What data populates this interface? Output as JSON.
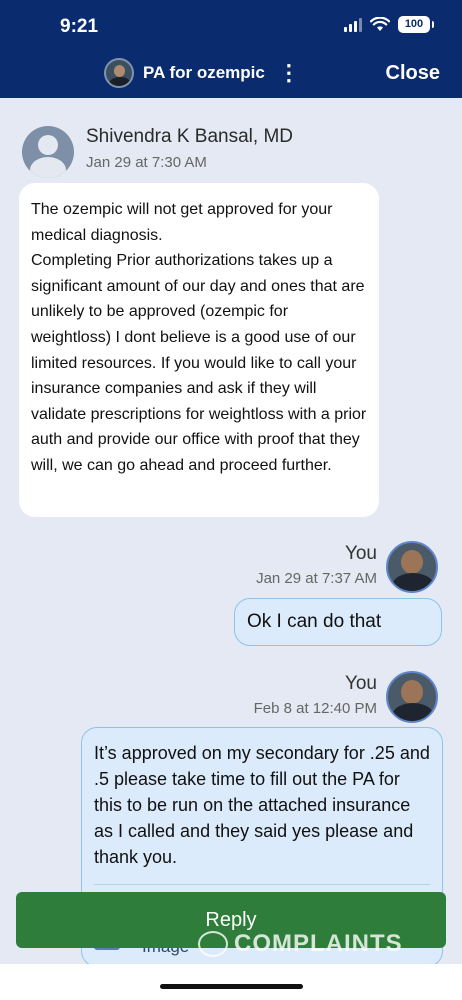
{
  "status_bar": {
    "time": "9:21",
    "battery": "100",
    "icons": [
      "signal-icon",
      "wifi-icon",
      "battery-icon"
    ]
  },
  "nav": {
    "title": "PA for ozempic",
    "menu_icon": "more-vertical-icon",
    "close_label": "Close"
  },
  "messages": [
    {
      "sender": "Shivendra K Bansal, MD",
      "time": "Jan 29 at 7:30 AM",
      "text": "The ozempic will not get approved for your medical diagnosis.\nCompleting Prior authorizations takes up a significant amount of our day and ones that are unlikely to be approved (ozempic for weightloss) I dont believe is a good use of our limited resources. If you would like to call your insurance companies and ask if they will validate prescriptions for weightloss with a prior auth and provide our office with proof that they will, we can go ahead and proceed further."
    },
    {
      "sender": "You",
      "time": "Jan 29 at 7:37 AM",
      "text": "Ok I can do that"
    },
    {
      "sender": "You",
      "time": "Feb 8 at 12:40 PM",
      "text": "It’s approved on my secondary for .25 and .5 please take time to fill out the PA for this to be run on the attached insurance as I called and they said yes please and thank you.",
      "attachment_label": "Image"
    }
  ],
  "reply_label": "Reply",
  "watermark": "COMPLAINTS",
  "colors": {
    "header_bg": "#0a2b6e",
    "page_bg": "#e4e9f4",
    "outgoing_bubble": "#dcebfb",
    "reply_button": "#2e7d3a"
  }
}
